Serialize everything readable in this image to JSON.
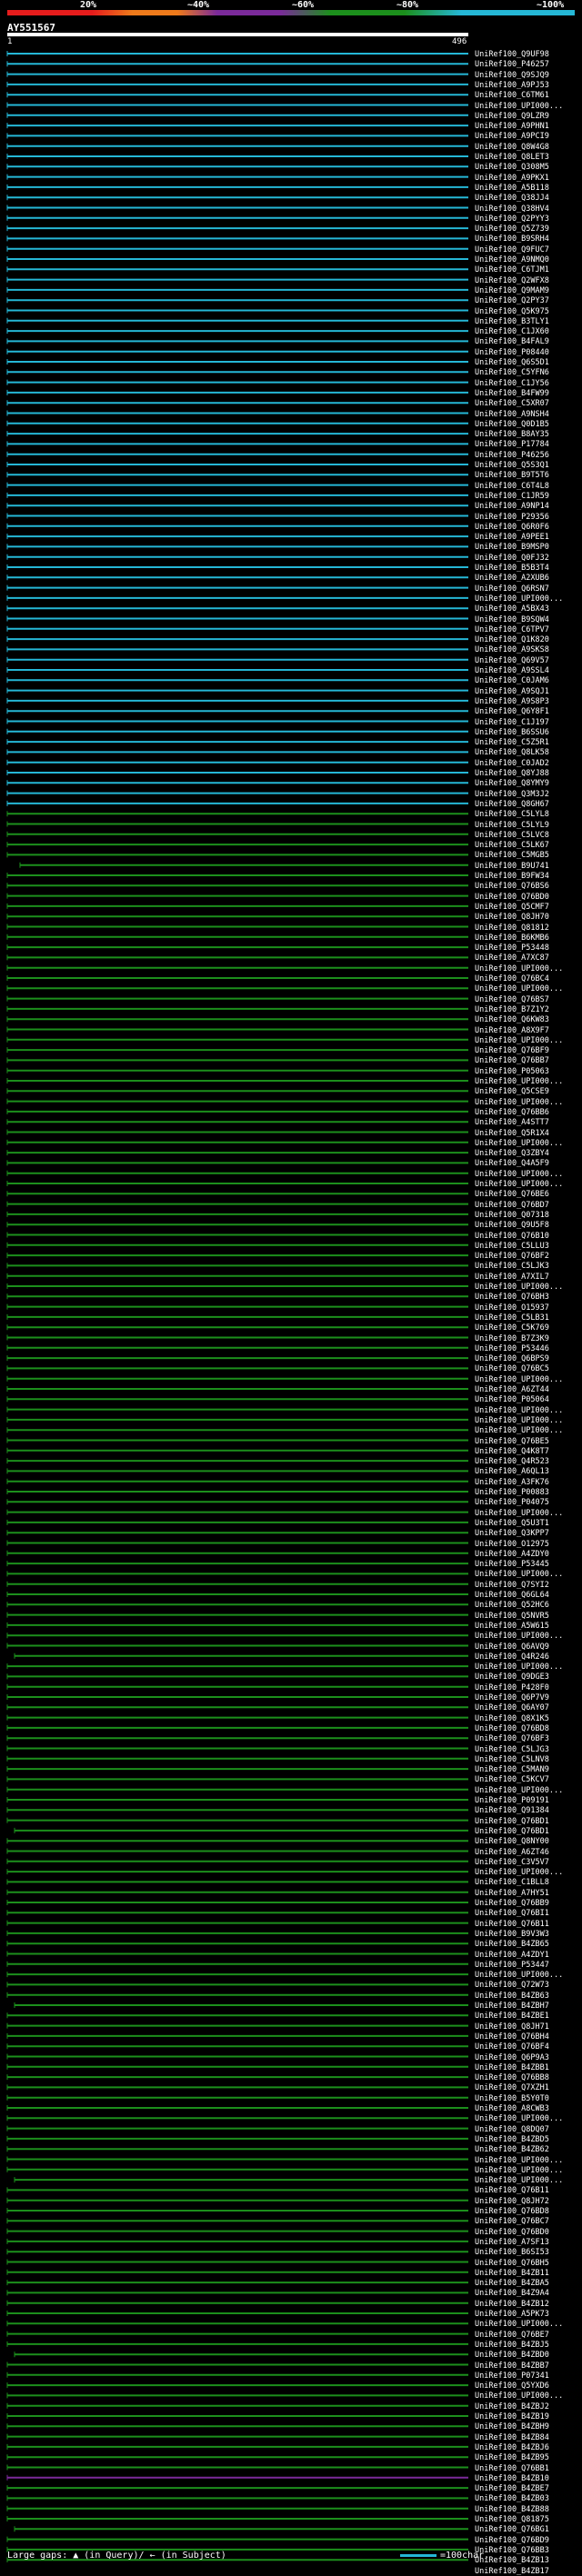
{
  "legend": {
    "ticks": [
      "20%",
      "~40%",
      "~60%",
      "~80%",
      "~100%"
    ],
    "colors": [
      "#e61c1c",
      "#ee7a1b",
      "#7b2a9a",
      "#1c8f1c",
      "#25b7d6"
    ]
  },
  "query": {
    "name": "AY551567",
    "start": "1",
    "end": "496"
  },
  "hits": [
    "UniRef100_Q9UF98",
    "UniRef100_P46257",
    "UniRef100_Q9SJQ9",
    "UniRef100_A9PJ53",
    "UniRef100_C6TM61",
    "UniRef100_UPI000...",
    "UniRef100_Q9LZR9",
    "UniRef100_A9PHN1",
    "UniRef100_A9PCI9",
    "UniRef100_Q8W4G8",
    "UniRef100_Q8LET3",
    "UniRef100_Q308M5",
    "UniRef100_A9PKX1",
    "UniRef100_A5B118",
    "UniRef100_Q38JJ4",
    "UniRef100_Q38HV4",
    "UniRef100_Q2PYY3",
    "UniRef100_Q5Z739",
    "UniRef100_B9SRH4",
    "UniRef100_Q9FUC7",
    "UniRef100_A9NMQ0",
    "UniRef100_C6TJM1",
    "UniRef100_Q2WFX8",
    "UniRef100_Q9MAM9",
    "UniRef100_Q2PY37",
    "UniRef100_Q5K975",
    "UniRef100_B3TLY1",
    "UniRef100_C1JX60",
    "UniRef100_B4FAL9",
    "UniRef100_P08440",
    "UniRef100_Q6S5D1",
    "UniRef100_C5YFN6",
    "UniRef100_C1JY56",
    "UniRef100_B4FW99",
    "UniRef100_C5XR07",
    "UniRef100_A9NSH4",
    "UniRef100_Q0D1B5",
    "UniRef100_B8AY35",
    "UniRef100_P17784",
    "UniRef100_P46256",
    "UniRef100_Q5S3Q1",
    "UniRef100_B9T5T6",
    "UniRef100_C6T4L8",
    "UniRef100_C1JR59",
    "UniRef100_A9NP14",
    "UniRef100_P29356",
    "UniRef100_Q6R0F6",
    "UniRef100_A9PEE1",
    "UniRef100_B9MSP0",
    "UniRef100_Q0FJ32",
    "UniRef100_B5B3T4",
    "UniRef100_A2XUB6",
    "UniRef100_Q6RSN7",
    "UniRef100_UPI000...",
    "UniRef100_A5BX43",
    "UniRef100_B9SQW4",
    "UniRef100_C6TPV7",
    "UniRef100_Q1K820",
    "UniRef100_A9SKS8",
    "UniRef100_Q69V57",
    "UniRef100_A9SSL4",
    "UniRef100_C0JAM6",
    "UniRef100_A9SQJ1",
    "UniRef100_A9S8P3",
    "UniRef100_Q6Y8F1",
    "UniRef100_C1J197",
    "UniRef100_B6SSU6",
    "UniRef100_C5Z5R1",
    "UniRef100_Q8LK58",
    "UniRef100_C0JAD2",
    "UniRef100_Q8YJ88",
    "UniRef100_Q8YMY9",
    "UniRef100_Q3M3J2",
    "UniRef100_Q8GH67",
    "UniRef100_C5LYL8",
    "UniRef100_C5LYL9",
    "UniRef100_C5LVC8",
    "UniRef100_C5LK67",
    "UniRef100_C5MGB5",
    "UniRef100_B9U741",
    "UniRef100_B9FW34",
    "UniRef100_Q76BS6",
    "UniRef100_Q76BD0",
    "UniRef100_Q5CMF7",
    "UniRef100_Q8JH70",
    "UniRef100_Q81812",
    "UniRef100_B6KMB6",
    "UniRef100_P53448",
    "UniRef100_A7XC87",
    "UniRef100_UPI000...",
    "UniRef100_Q76BC4",
    "UniRef100_UPI000...",
    "UniRef100_Q76BS7",
    "UniRef100_B7Z1Y2",
    "UniRef100_Q6KW83",
    "UniRef100_A8X9F7",
    "UniRef100_UPI000...",
    "UniRef100_Q76BF9",
    "UniRef100_Q76BB7",
    "UniRef100_P05063",
    "UniRef100_UPI000...",
    "UniRef100_Q5CSE9",
    "UniRef100_UPI000...",
    "UniRef100_Q76BB6",
    "UniRef100_A4STT7",
    "UniRef100_Q5R1X4",
    "UniRef100_UPI000...",
    "UniRef100_Q3ZBY4",
    "UniRef100_Q4A5F9",
    "UniRef100_UPI000...",
    "UniRef100_UPI000...",
    "UniRef100_Q76BE6",
    "UniRef100_Q76BD7",
    "UniRef100_Q07318",
    "UniRef100_Q9U5F8",
    "UniRef100_Q76B10",
    "UniRef100_C5LLU3",
    "UniRef100_Q76BF2",
    "UniRef100_C5LJK3",
    "UniRef100_A7XIL7",
    "UniRef100_UPI000...",
    "UniRef100_Q76BH3",
    "UniRef100_O15937",
    "UniRef100_C5LB31",
    "UniRef100_C5K769",
    "UniRef100_B7Z3K9",
    "UniRef100_P53446",
    "UniRef100_Q6BPS9",
    "UniRef100_Q76BC5",
    "UniRef100_UPI000...",
    "UniRef100_A6ZT44",
    "UniRef100_P05064",
    "UniRef100_UPI000...",
    "UniRef100_UPI000...",
    "UniRef100_UPI000...",
    "UniRef100_Q76BE5",
    "UniRef100_Q4K8T7",
    "UniRef100_Q4R523",
    "UniRef100_A6QL13",
    "UniRef100_A3FK76",
    "UniRef100_P00883",
    "UniRef100_P04075",
    "UniRef100_UPI000...",
    "UniRef100_Q5U3T1",
    "UniRef100_Q3KPP7",
    "UniRef100_O12975",
    "UniRef100_A4ZDY0",
    "UniRef100_P53445",
    "UniRef100_UPI000...",
    "UniRef100_Q7SYI2",
    "UniRef100_Q6GL64",
    "UniRef100_Q52HC6",
    "UniRef100_Q5NVR5",
    "UniRef100_A5W615",
    "UniRef100_UPI000...",
    "UniRef100_Q6AVQ9",
    "UniRef100_Q4R246",
    "UniRef100_UPI000...",
    "UniRef100_Q9DGE3",
    "UniRef100_P428F0",
    "UniRef100_Q6P7V9",
    "UniRef100_Q6AY07",
    "UniRef100_Q8X1K5",
    "UniRef100_Q76BD8",
    "UniRef100_Q76BF3",
    "UniRef100_C5LJG3",
    "UniRef100_C5LNV8",
    "UniRef100_C5MAN9",
    "UniRef100_C5KCV7",
    "UniRef100_UPI000...",
    "UniRef100_P09191",
    "UniRef100_Q91384",
    "UniRef100_Q76BD1",
    "UniRef100_Q76BD1",
    "UniRef100_Q8NY00",
    "UniRef100_A6ZT46",
    "UniRef100_C3V5V7",
    "UniRef100_UPI000...",
    "UniRef100_C1BLL8",
    "UniRef100_A7HY51",
    "UniRef100_Q76BB9",
    "UniRef100_Q76BI1",
    "UniRef100_Q76B11",
    "UniRef100_B9V3W3",
    "UniRef100_B4ZB65",
    "UniRef100_A4ZDY1",
    "UniRef100_P53447",
    "UniRef100_UPI000...",
    "UniRef100_Q72W73",
    "UniRef100_B4ZB63",
    "UniRef100_B4ZBH7",
    "UniRef100_B4ZBE1",
    "UniRef100_Q8JH71",
    "UniRef100_Q76BH4",
    "UniRef100_Q76BF4",
    "UniRef100_Q6P9A3",
    "UniRef100_B4ZBB1",
    "UniRef100_Q76BB8",
    "UniRef100_Q7XZH1",
    "UniRef100_B5Y0T0",
    "UniRef100_A8CWB3",
    "UniRef100_UPI000...",
    "UniRef100_Q8DQ07",
    "UniRef100_B4ZBD5",
    "UniRef100_B4ZB62",
    "UniRef100_UPI000...",
    "UniRef100_UPI000...",
    "UniRef100_UPI000...",
    "UniRef100_Q76B11",
    "UniRef100_Q8JH72",
    "UniRef100_Q76BD8",
    "UniRef100_Q76BC7",
    "UniRef100_Q76BD0",
    "UniRef100_A7SF13",
    "UniRef100_B6SI53",
    "UniRef100_Q76BH5",
    "UniRef100_B4ZB11",
    "UniRef100_B4ZBA5",
    "UniRef100_B4Z9A4",
    "UniRef100_B4ZB12",
    "UniRef100_A5PK73",
    "UniRef100_UPI000...",
    "UniRef100_Q76BE7",
    "UniRef100_B4ZBJ5",
    "UniRef100_B4ZBD0",
    "UniRef100_B4ZBB7",
    "UniRef100_P07341",
    "UniRef100_Q5YXD6",
    "UniRef100_UPI000...",
    "UniRef100_B4ZBJ2",
    "UniRef100_B4ZB19",
    "UniRef100_B4ZBH9",
    "UniRef100_B4ZB84",
    "UniRef100_B4ZBJ6",
    "UniRef100_B4ZB95",
    "UniRef100_Q76BB1",
    "UniRef100_B4ZB10",
    "UniRef100_B4ZBE7",
    "UniRef100_B4ZB03",
    "UniRef100_B4ZB88",
    "UniRef100_Q81875",
    "UniRef100_Q76BG1",
    "UniRef100_Q76BD9",
    "UniRef100_Q76BB3",
    "UniRef100_B4ZB13",
    "UniRef100_B4ZB17"
  ],
  "footer": {
    "gaps_label": "Large gaps: ▲ (in Query)/ ← (in Subject)",
    "scale_label": "=100char."
  }
}
